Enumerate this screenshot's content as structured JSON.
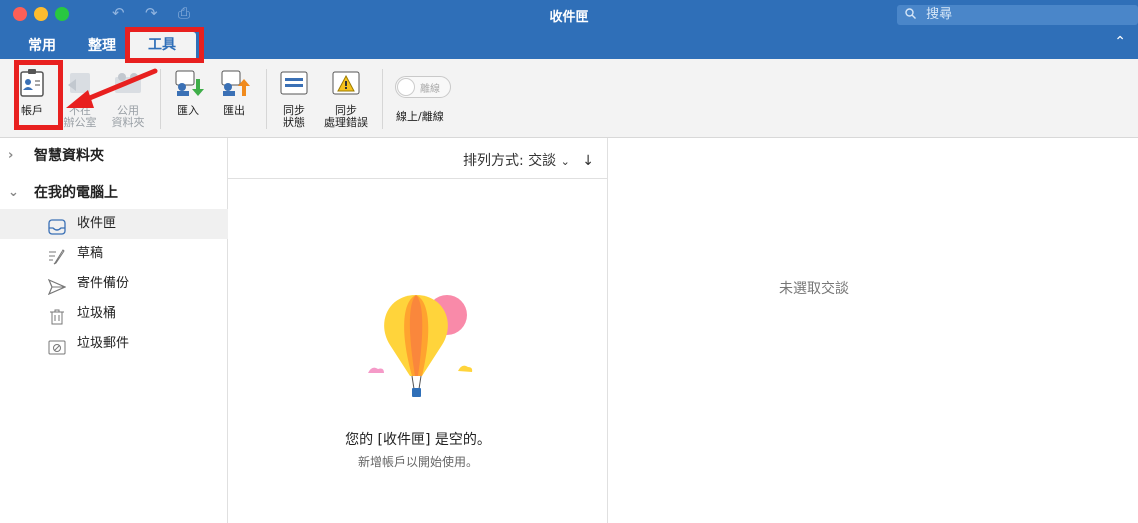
{
  "window": {
    "title": "收件匣"
  },
  "search": {
    "placeholder": "搜尋"
  },
  "tabs": [
    {
      "label": "常用"
    },
    {
      "label": "整理"
    },
    {
      "label": "工具",
      "active": true
    }
  ],
  "ribbon": {
    "account": "帳戶",
    "out_of_office": "不在\n辦公室",
    "public_folders": "公用\n資料夾",
    "import": "匯入",
    "export": "匯出",
    "sync_status": "同步\n狀態",
    "sync_errors": "同步\n處理錯誤",
    "online_toggle_state": "離線",
    "online_offline": "線上/離線"
  },
  "sidebar": {
    "smart_folders": "智慧資料夾",
    "on_my_computer": "在我的電腦上",
    "folders": [
      {
        "label": "收件匣",
        "icon": "inbox-icon",
        "selected": true
      },
      {
        "label": "草稿",
        "icon": "drafts-icon"
      },
      {
        "label": "寄件備份",
        "icon": "sent-icon"
      },
      {
        "label": "垃圾桶",
        "icon": "trash-icon"
      },
      {
        "label": "垃圾郵件",
        "icon": "junk-icon"
      }
    ]
  },
  "message_list": {
    "sort_label": "排列方式: 交談",
    "empty_title": "您的 [收件匣] 是空的。",
    "empty_subtitle": "新增帳戶以開始使用。"
  },
  "reading_pane": {
    "empty_text": "未選取交談"
  },
  "colors": {
    "accent": "#2f6fb8",
    "annotation": "#e8201f"
  }
}
